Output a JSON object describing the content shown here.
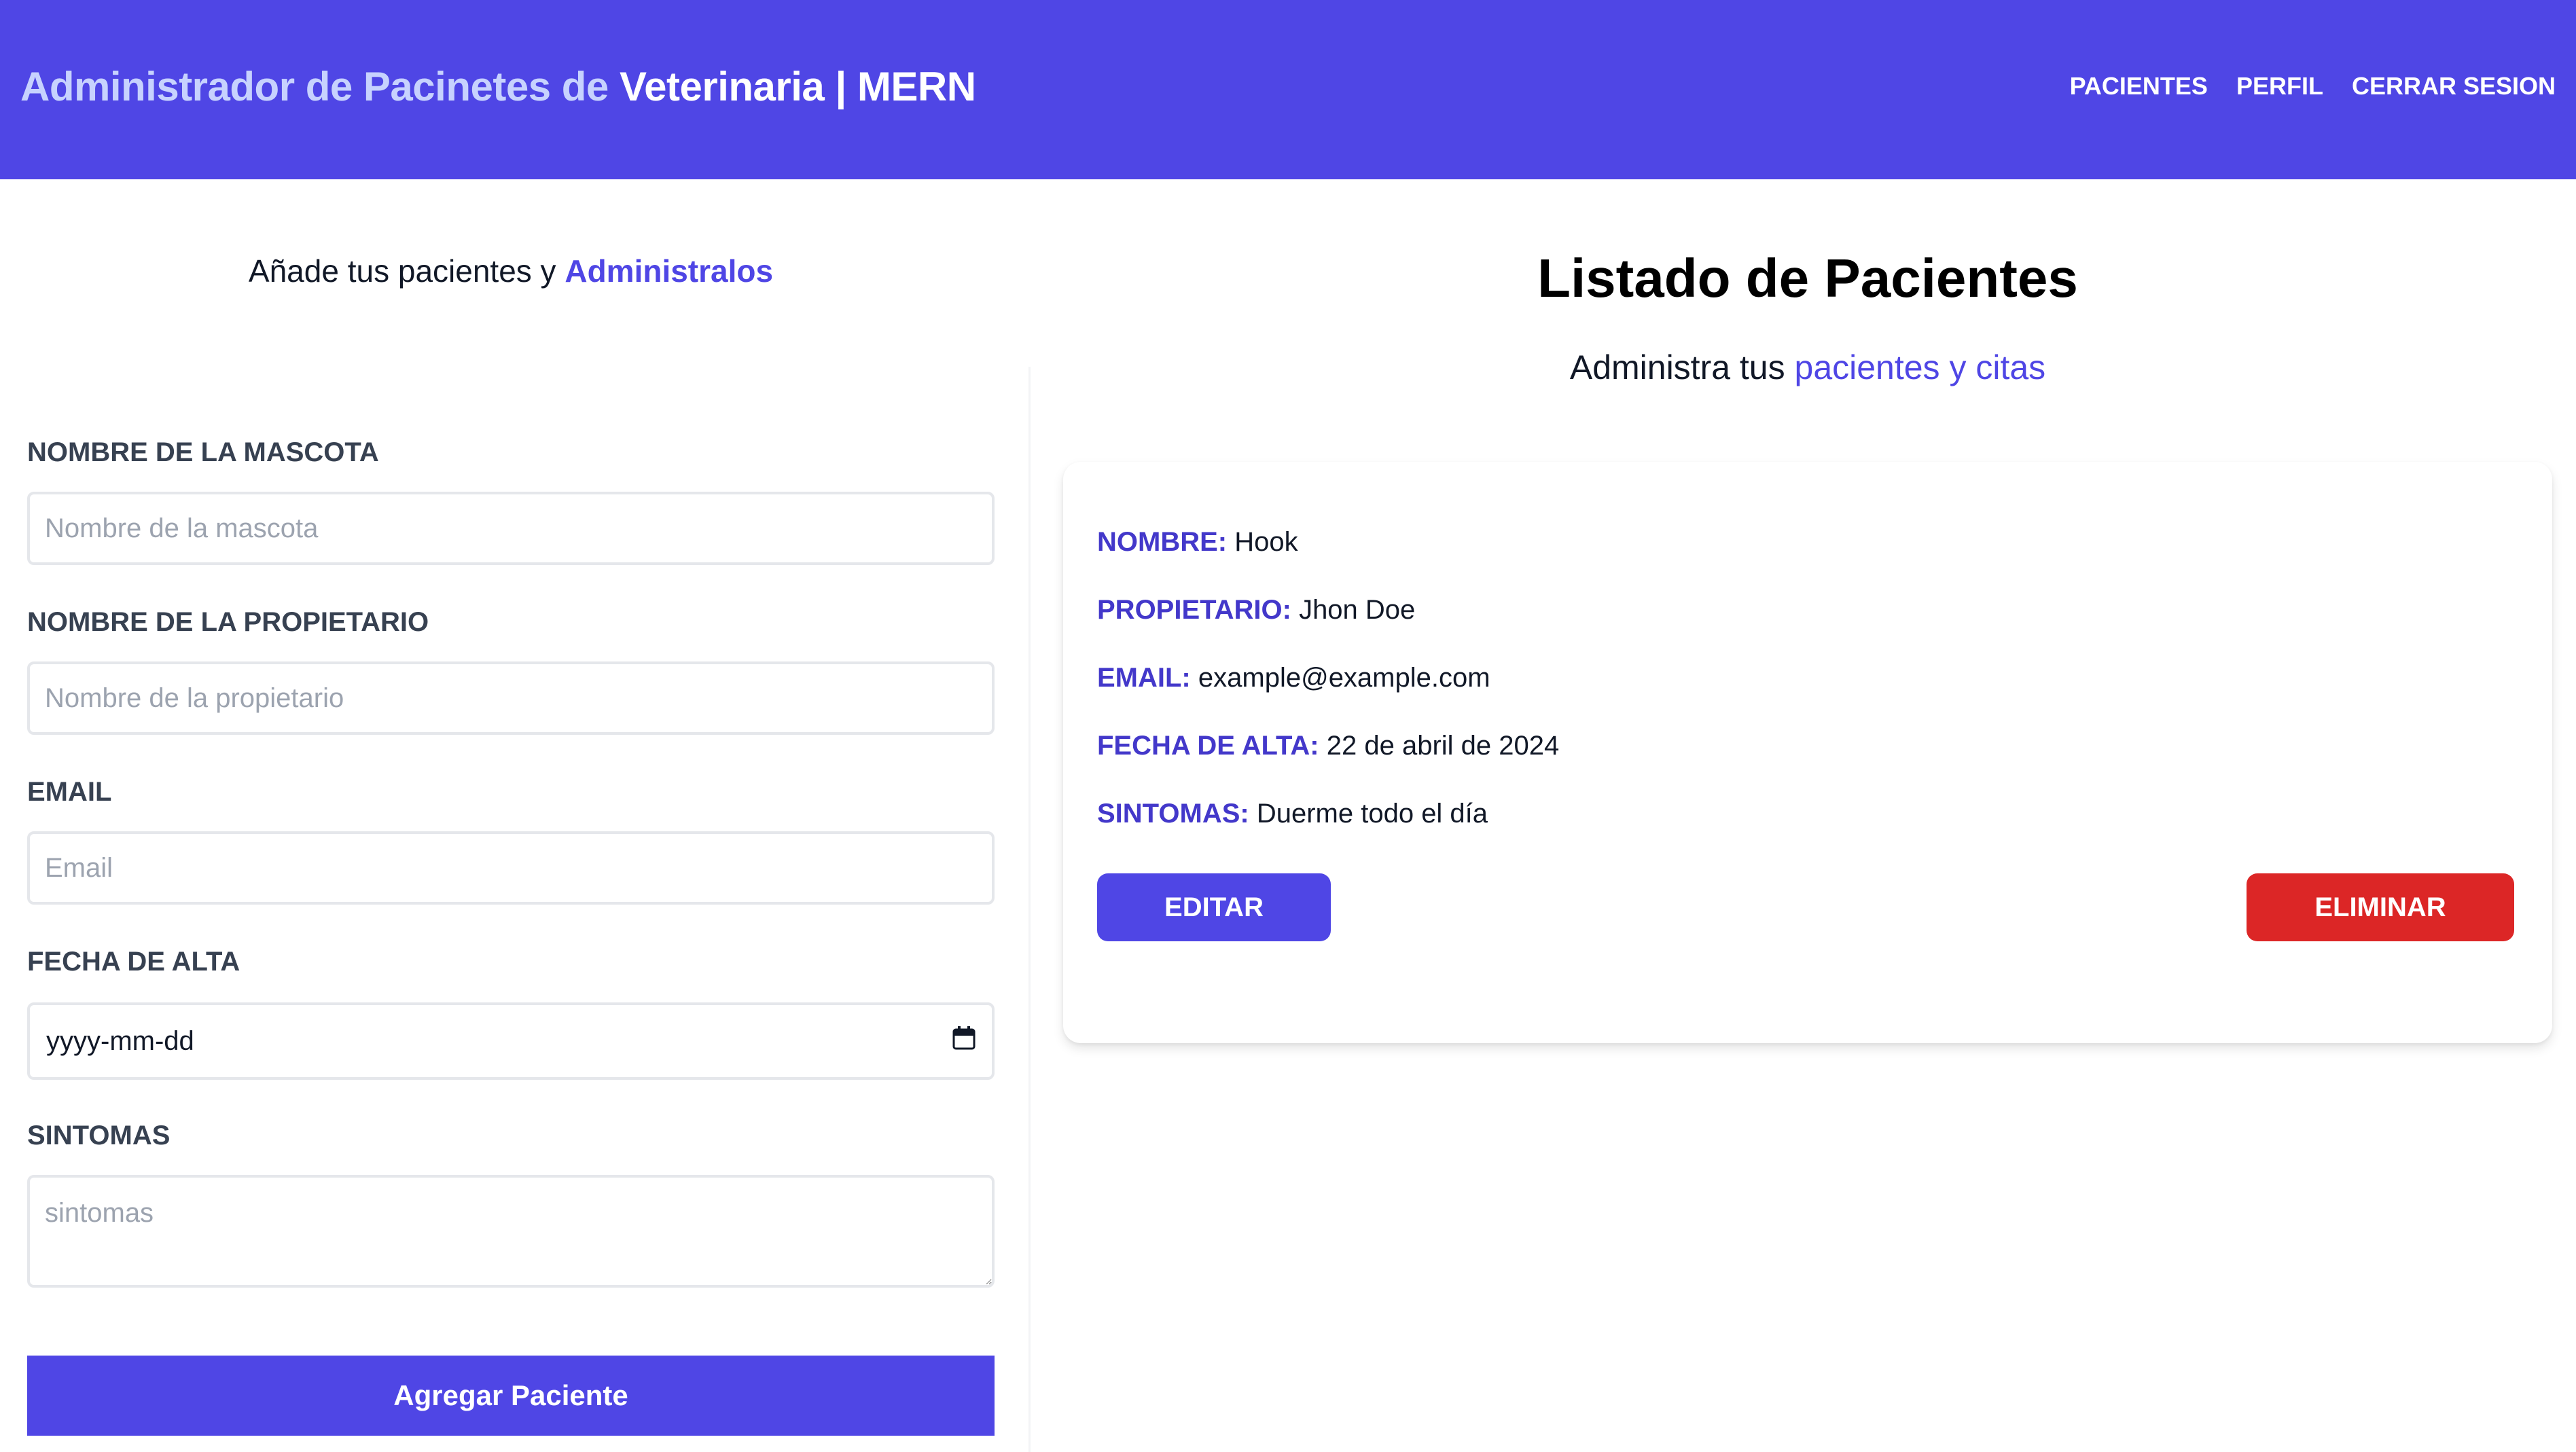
{
  "header": {
    "title_part1": "Administrador de Pacinetes de ",
    "title_part2": "Veterinaria | MERN",
    "nav": [
      "Pacientes",
      "Perfil",
      "Cerrar Sesion"
    ]
  },
  "form": {
    "tagline_prefix": "Añade tus pacientes y ",
    "tagline_accent": "Administralos",
    "fields": {
      "pet_name": {
        "label": "Nombre de la mascota",
        "placeholder": "Nombre de la mascota"
      },
      "owner_name": {
        "label": "Nombre de la propietario",
        "placeholder": "Nombre de la propietario"
      },
      "email": {
        "label": "Email",
        "placeholder": "Email"
      },
      "date": {
        "label": "Fecha de Alta",
        "value": "yyyy-mm-dd"
      },
      "symptoms": {
        "label": "Sintomas",
        "placeholder": "sintomas"
      }
    },
    "submit_label": "Agregar Paciente"
  },
  "patients": {
    "title": "Listado de Pacientes",
    "subtitle_prefix": "Administra tus ",
    "subtitle_accent": "pacientes y citas",
    "items": [
      {
        "nombre_label": "Nombre:",
        "nombre": "Hook",
        "propietario_label": "Propietario:",
        "propietario": "Jhon Doe",
        "email_label": "Email:",
        "email": "example@example.com",
        "fecha_label": "Fecha de Alta:",
        "fecha": "22 de abril de 2024",
        "sintomas_label": "Sintomas:",
        "sintomas": "Duerme todo el día",
        "edit_label": "Editar",
        "delete_label": "Eliminar"
      }
    ]
  },
  "colors": {
    "primary": "#4f46e5",
    "primary_light": "#c7d2fe",
    "accent_dark": "#4338ca",
    "danger": "#dc2626"
  },
  "icons": {
    "date_picker": "calendar-icon"
  }
}
